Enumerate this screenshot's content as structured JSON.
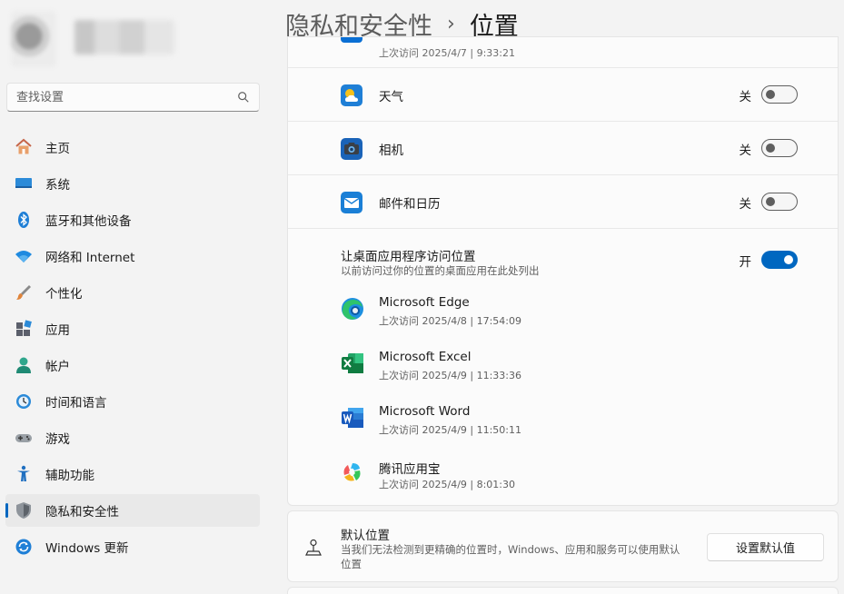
{
  "search": {
    "placeholder": "查找设置"
  },
  "nav": [
    {
      "label": "主页",
      "icon": "home-icon"
    },
    {
      "label": "系统",
      "icon": "system-icon"
    },
    {
      "label": "蓝牙和其他设备",
      "icon": "bluetooth-icon"
    },
    {
      "label": "网络和 Internet",
      "icon": "wifi-icon"
    },
    {
      "label": "个性化",
      "icon": "brush-icon"
    },
    {
      "label": "应用",
      "icon": "apps-icon"
    },
    {
      "label": "帐户",
      "icon": "account-icon"
    },
    {
      "label": "时间和语言",
      "icon": "time-language-icon"
    },
    {
      "label": "游戏",
      "icon": "gamepad-icon"
    },
    {
      "label": "辅助功能",
      "icon": "accessibility-icon"
    },
    {
      "label": "隐私和安全性",
      "icon": "shield-icon",
      "active": true
    },
    {
      "label": "Windows 更新",
      "icon": "windows-update-icon"
    }
  ],
  "header": {
    "parent": "隐私和安全性",
    "separator": "›",
    "current": "位置"
  },
  "partial_row": {
    "meta": "上次访问 2025/4/7 | 9:33:21"
  },
  "store_apps": [
    {
      "name": "天气",
      "icon": "weather-icon",
      "state_label": "关",
      "on": false
    },
    {
      "name": "相机",
      "icon": "camera-icon",
      "state_label": "关",
      "on": false
    },
    {
      "name": "邮件和日历",
      "icon": "mail-icon",
      "state_label": "关",
      "on": false
    }
  ],
  "desktop": {
    "title": "让桌面应用程序访问位置",
    "subtitle": "以前访问过你的位置的桌面应用在此处列出",
    "state_label": "开",
    "on": true,
    "apps": [
      {
        "name": "Microsoft Edge",
        "last_access": "上次访问 2025/4/8  |  17:54:09",
        "icon": "edge-icon"
      },
      {
        "name": "Microsoft Excel",
        "last_access": "上次访问 2025/4/9  |  11:33:36",
        "icon": "excel-icon"
      },
      {
        "name": "Microsoft Word",
        "last_access": "上次访问 2025/4/9  |  11:50:11",
        "icon": "word-icon"
      },
      {
        "name": "腾讯应用宝",
        "last_access": "上次访问 2025/4/9  |  8:01:30",
        "icon": "tencent-appstore-icon"
      }
    ]
  },
  "default_location": {
    "title": "默认位置",
    "description": "当我们无法检测到更精确的位置时，Windows、应用和服务可以使用默认位置",
    "button": "设置默认值",
    "icon": "map-pin-icon"
  },
  "colors": {
    "accent": "#0067c0",
    "background": "#f3f3f3",
    "card": "#fbfbfb"
  }
}
